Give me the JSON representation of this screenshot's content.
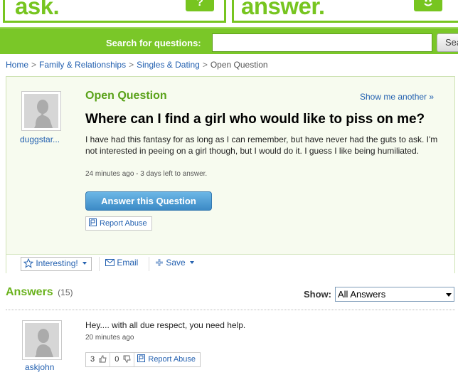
{
  "header": {
    "ask_title": "ask.",
    "ask_button_label": "?",
    "answer_title": "answer.",
    "answer_button_icon": "smiley-icon"
  },
  "search": {
    "label": "Search for questions:",
    "value": "",
    "button_label": "Sea"
  },
  "breadcrumb": {
    "items": [
      "Home",
      "Family & Relationships",
      "Singles & Dating"
    ],
    "current": "Open Question",
    "separator": ">"
  },
  "question": {
    "status_label": "Open Question",
    "show_another": "Show me another »",
    "username": "duggstar...",
    "title": "Where can I find a girl who would like to piss on me?",
    "body": "I have had this fantasy for as long as I can remember, but have never had the guts to ask. I'm not interested in peeing on a girl though, but I would do it. I guess I like being humiliated.",
    "meta": "24 minutes ago - 3 days left to answer.",
    "answer_button": "Answer this Question",
    "report_abuse": "Report Abuse"
  },
  "question_actions": {
    "interesting": "Interesting!",
    "email": "Email",
    "save": "Save"
  },
  "answers": {
    "heading": "Answers",
    "count": "(15)",
    "show_label": "Show:",
    "show_selected": "All Answers",
    "items": [
      {
        "username": "askjohn",
        "text": "Hey.... with all due respect, you need help.",
        "meta": "20 minutes ago",
        "thumbs_up": "3",
        "thumbs_down": "0",
        "report_abuse": "Report Abuse"
      }
    ]
  },
  "colors": {
    "brand_green": "#77c520",
    "link_blue": "#2461b0",
    "button_blue": "#3c8ac6",
    "panel_bg": "#f7fbef"
  }
}
